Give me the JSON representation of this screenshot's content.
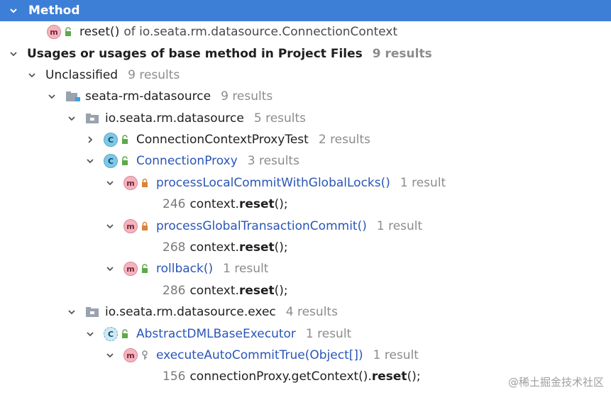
{
  "header": {
    "title": "Method"
  },
  "method_row": {
    "name": "reset()",
    "of_text": "of io.seata.rm.datasource.ConnectionContext"
  },
  "usages": {
    "title": "Usages or usages of base method in Project Files",
    "count": "9 results"
  },
  "unclassified": {
    "label": "Unclassified",
    "count": "9 results"
  },
  "module": {
    "label": "seata-rm-datasource",
    "count": "9 results"
  },
  "pkg1": {
    "label": "io.seata.rm.datasource",
    "count": "5 results"
  },
  "class1": {
    "label": "ConnectionContextProxyTest",
    "count": "2 results"
  },
  "class2": {
    "label": "ConnectionProxy",
    "count": "3 results"
  },
  "m1": {
    "label": "processLocalCommitWithGlobalLocks()",
    "count": "1 result",
    "line": "246",
    "code_prefix": "context.",
    "code_bold": "reset",
    "code_suffix": "();"
  },
  "m2": {
    "label": "processGlobalTransactionCommit()",
    "count": "1 result",
    "line": "268",
    "code_prefix": "context.",
    "code_bold": "reset",
    "code_suffix": "();"
  },
  "m3": {
    "label": "rollback()",
    "count": "1 result",
    "line": "286",
    "code_prefix": "context.",
    "code_bold": "reset",
    "code_suffix": "();"
  },
  "pkg2": {
    "label": "io.seata.rm.datasource.exec",
    "count": "4 results"
  },
  "class3": {
    "label": "AbstractDMLBaseExecutor",
    "count": "1 result"
  },
  "m4": {
    "label": "executeAutoCommitTrue(Object[])",
    "count": "1 result",
    "line": "156",
    "code_prefix": "connectionProxy.getContext().",
    "code_bold": "reset",
    "code_suffix": "();"
  },
  "watermark": "@稀土掘金技术社区",
  "colors": {
    "header_bg": "#3d7fd6",
    "link": "#2a55b8",
    "muted": "#8c8c8c"
  }
}
